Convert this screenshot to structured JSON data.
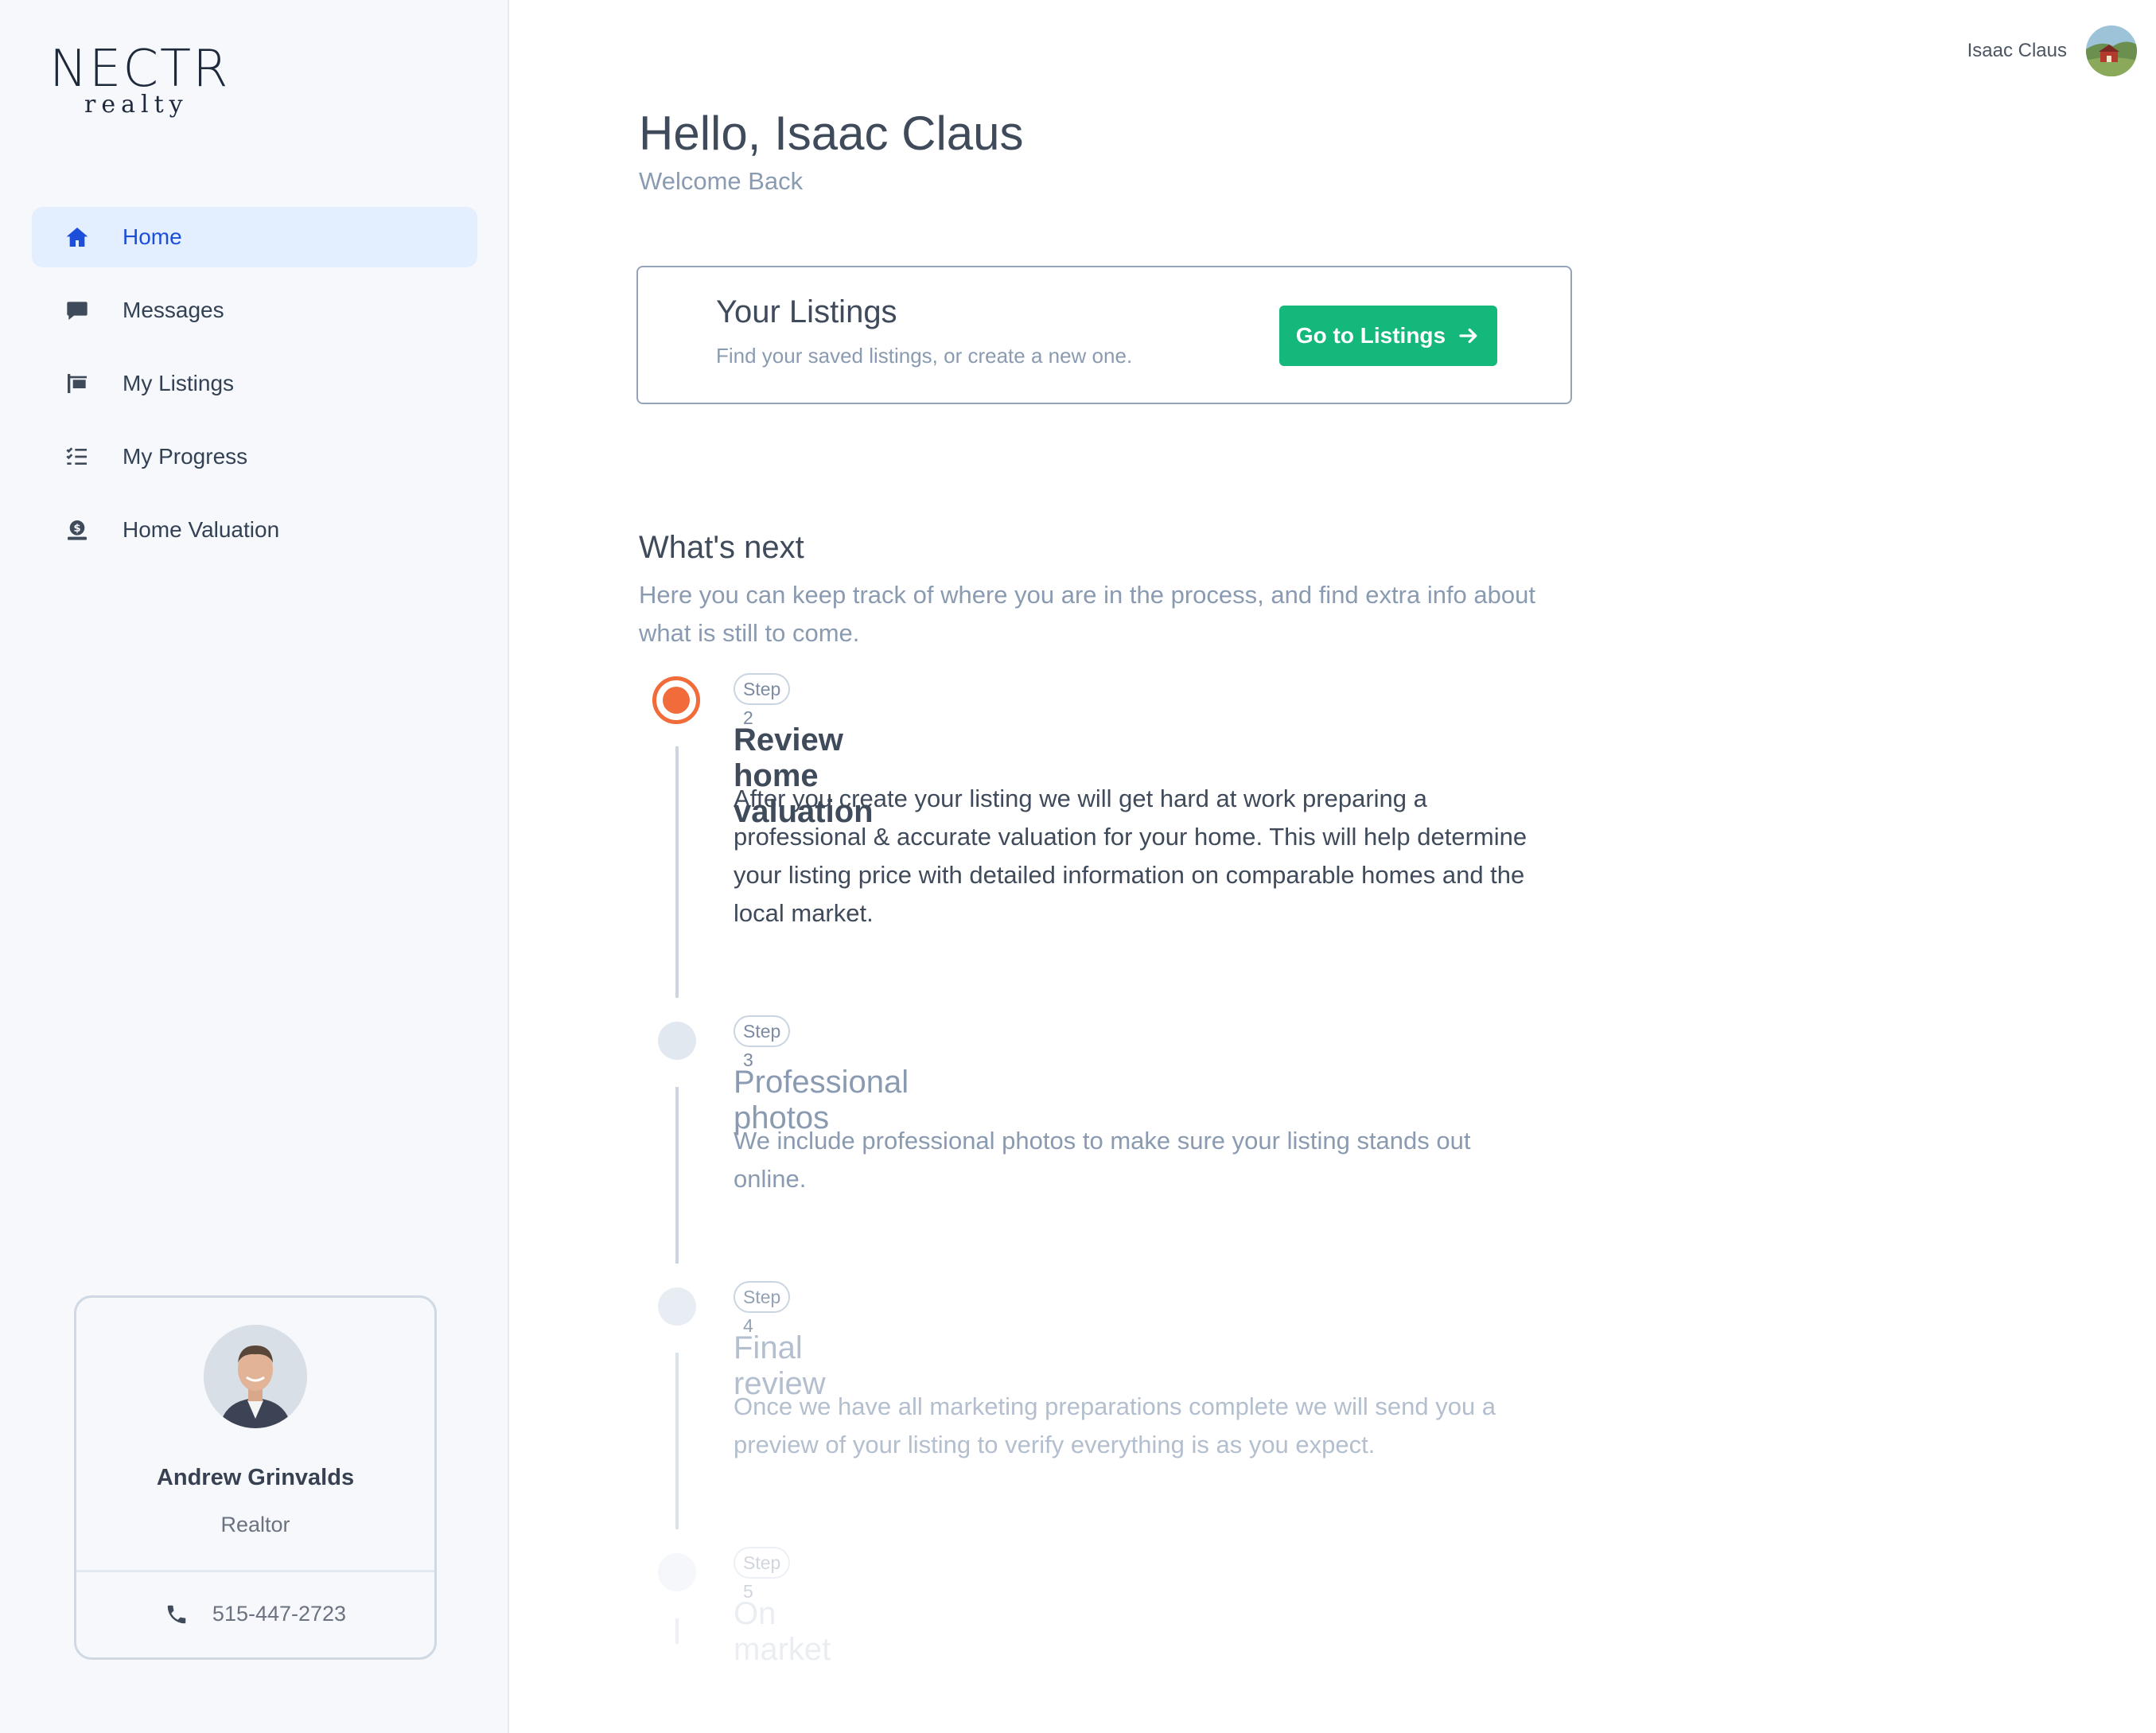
{
  "brand": {
    "logo_word": "NECTR",
    "logo_sub": "realty"
  },
  "sidebar": {
    "items": [
      {
        "label": "Home",
        "icon": "home-icon",
        "active": true
      },
      {
        "label": "Messages",
        "icon": "chat-bubble-icon",
        "active": false
      },
      {
        "label": "My Listings",
        "icon": "sign-post-icon",
        "active": false
      },
      {
        "label": "My Progress",
        "icon": "checklist-icon",
        "active": false
      },
      {
        "label": "Home Valuation",
        "icon": "valuation-icon",
        "active": false
      }
    ],
    "agent": {
      "name": "Andrew Grinvalds",
      "role": "Realtor",
      "phone": "515-447-2723"
    }
  },
  "header": {
    "user_name": "Isaac Claus"
  },
  "main": {
    "greeting": "Hello, Isaac Claus",
    "welcome": "Welcome Back",
    "listings_card": {
      "title": "Your Listings",
      "subtitle": "Find your saved listings, or create a new one.",
      "button_label": "Go to Listings"
    },
    "whats_next": {
      "title": "What's next",
      "subtitle": "Here you can keep track of where you are in the process, and find extra info about what is still to come."
    },
    "steps": [
      {
        "badge": "Step 2",
        "title": "Review home valuation",
        "description": "After you create your listing we will get hard at work preparing a professional & accurate valuation for your home. This will help determine your listing price with detailed information on comparable homes and the local market.",
        "status": "current"
      },
      {
        "badge": "Step 3",
        "title": "Professional photos",
        "description": "We include professional photos to make sure your listing stands out online.",
        "status": "upcoming"
      },
      {
        "badge": "Step 4",
        "title": "Final review",
        "description": "Once we have all marketing preparations complete we will send you a preview of your listing to verify everything is as you expect.",
        "status": "upcoming"
      },
      {
        "badge": "Step 5",
        "title": "On market",
        "description": "",
        "status": "upcoming"
      }
    ]
  },
  "colors": {
    "accent_blue": "#1d4ed8",
    "active_nav_bg": "#e3eefe",
    "button_green": "#14b87a",
    "current_step_orange": "#f26b3a"
  }
}
